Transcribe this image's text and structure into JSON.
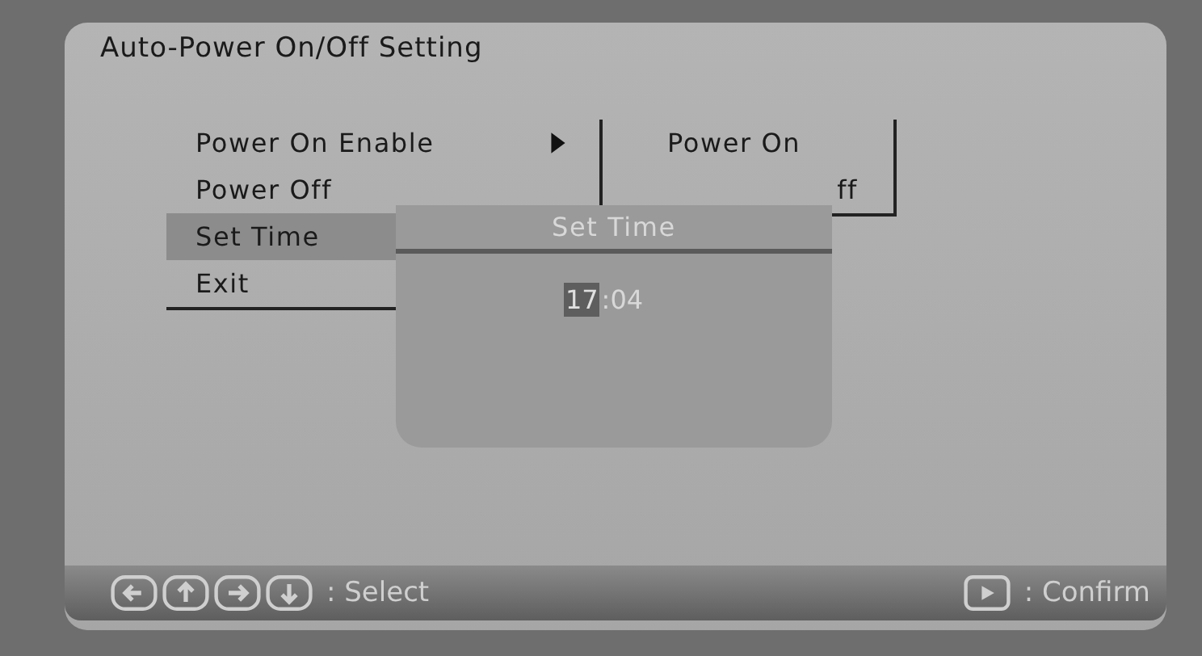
{
  "window": {
    "title": "Auto-Power On/Off Setting"
  },
  "menu": {
    "items": [
      {
        "label": "Power On Enable",
        "has_submenu": true,
        "selected": false
      },
      {
        "label": "Power Off",
        "has_submenu": false,
        "selected": false
      },
      {
        "label": "Set Time",
        "has_submenu": false,
        "selected": true
      },
      {
        "label": "Exit",
        "has_submenu": false,
        "selected": false
      }
    ]
  },
  "submenu": {
    "items": [
      {
        "label": "Power On"
      },
      {
        "label": "ff"
      }
    ]
  },
  "dialog": {
    "title": "Set Time",
    "time": [
      {
        "text": "17",
        "selected": true
      },
      {
        "text": ":04",
        "selected": false
      }
    ]
  },
  "footer": {
    "select_label": ": Select",
    "select_keys": [
      {
        "kind": "left"
      },
      {
        "kind": "up"
      },
      {
        "kind": "right"
      },
      {
        "kind": "down"
      }
    ],
    "confirm_label": ": Confirm"
  }
}
